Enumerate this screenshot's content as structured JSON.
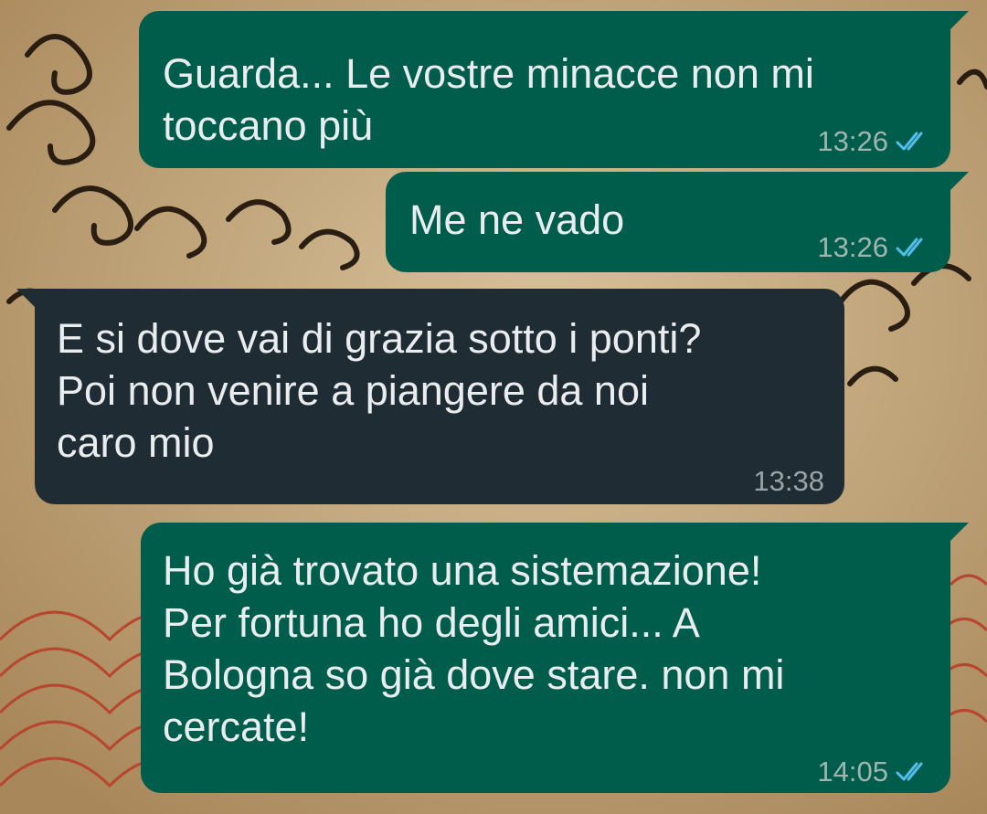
{
  "colors": {
    "outgoing_bubble": "#005c4b",
    "incoming_bubble": "#202c33",
    "read_ticks": "#53bdeb",
    "wallpaper": "#c9b08a"
  },
  "messages": [
    {
      "direction": "outgoing",
      "text": "Guarda... Le vostre minacce non mi\ntoccano più",
      "time": "13:26",
      "status_icon": "double-check-icon"
    },
    {
      "direction": "outgoing",
      "text": "Me ne vado",
      "time": "13:26",
      "status_icon": "double-check-icon"
    },
    {
      "direction": "incoming",
      "text": "E si dove vai di grazia sotto i ponti?\nPoi non venire a piangere da noi\ncaro mio",
      "time": "13:38"
    },
    {
      "direction": "outgoing",
      "text": "Ho già trovato una sistemazione!\nPer fortuna ho degli amici... A\nBologna so già dove stare. non mi\ncercate!",
      "time": "14:05",
      "status_icon": "double-check-icon"
    }
  ]
}
